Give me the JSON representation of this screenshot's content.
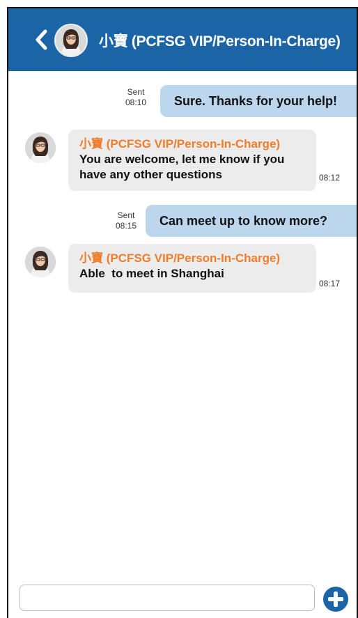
{
  "header": {
    "back_icon": "chevron-left-icon",
    "avatar_icon": "person-avatar-icon",
    "title": "小寶 (PCFSG VIP/Person-In-Charge)"
  },
  "messages": [
    {
      "direction": "outgoing",
      "status": "Sent",
      "time": "08:10",
      "text": "Sure. Thanks for your help!"
    },
    {
      "direction": "incoming",
      "sender": "小寶 (PCFSG VIP/Person-In-Charge)",
      "line1": "You are welcome, let me know if you",
      "line2": "have any other questions",
      "time": "08:12"
    },
    {
      "direction": "outgoing",
      "status": "Sent",
      "time": "08:15",
      "text": "Can meet up to know more?"
    },
    {
      "direction": "incoming",
      "sender": "小寶 (PCFSG VIP/Person-In-Charge)",
      "line1": "Able  to meet in Shanghai",
      "time": "08:17"
    }
  ],
  "composer": {
    "input_value": "",
    "input_placeholder": "",
    "add_icon": "plus-circle-icon"
  },
  "colors": {
    "header_bg": "#1b64a6",
    "outgoing_bubble": "#bcd6ee",
    "incoming_bubble": "#ececec",
    "sender_name": "#ef7d2b",
    "add_button": "#1b64a6"
  }
}
